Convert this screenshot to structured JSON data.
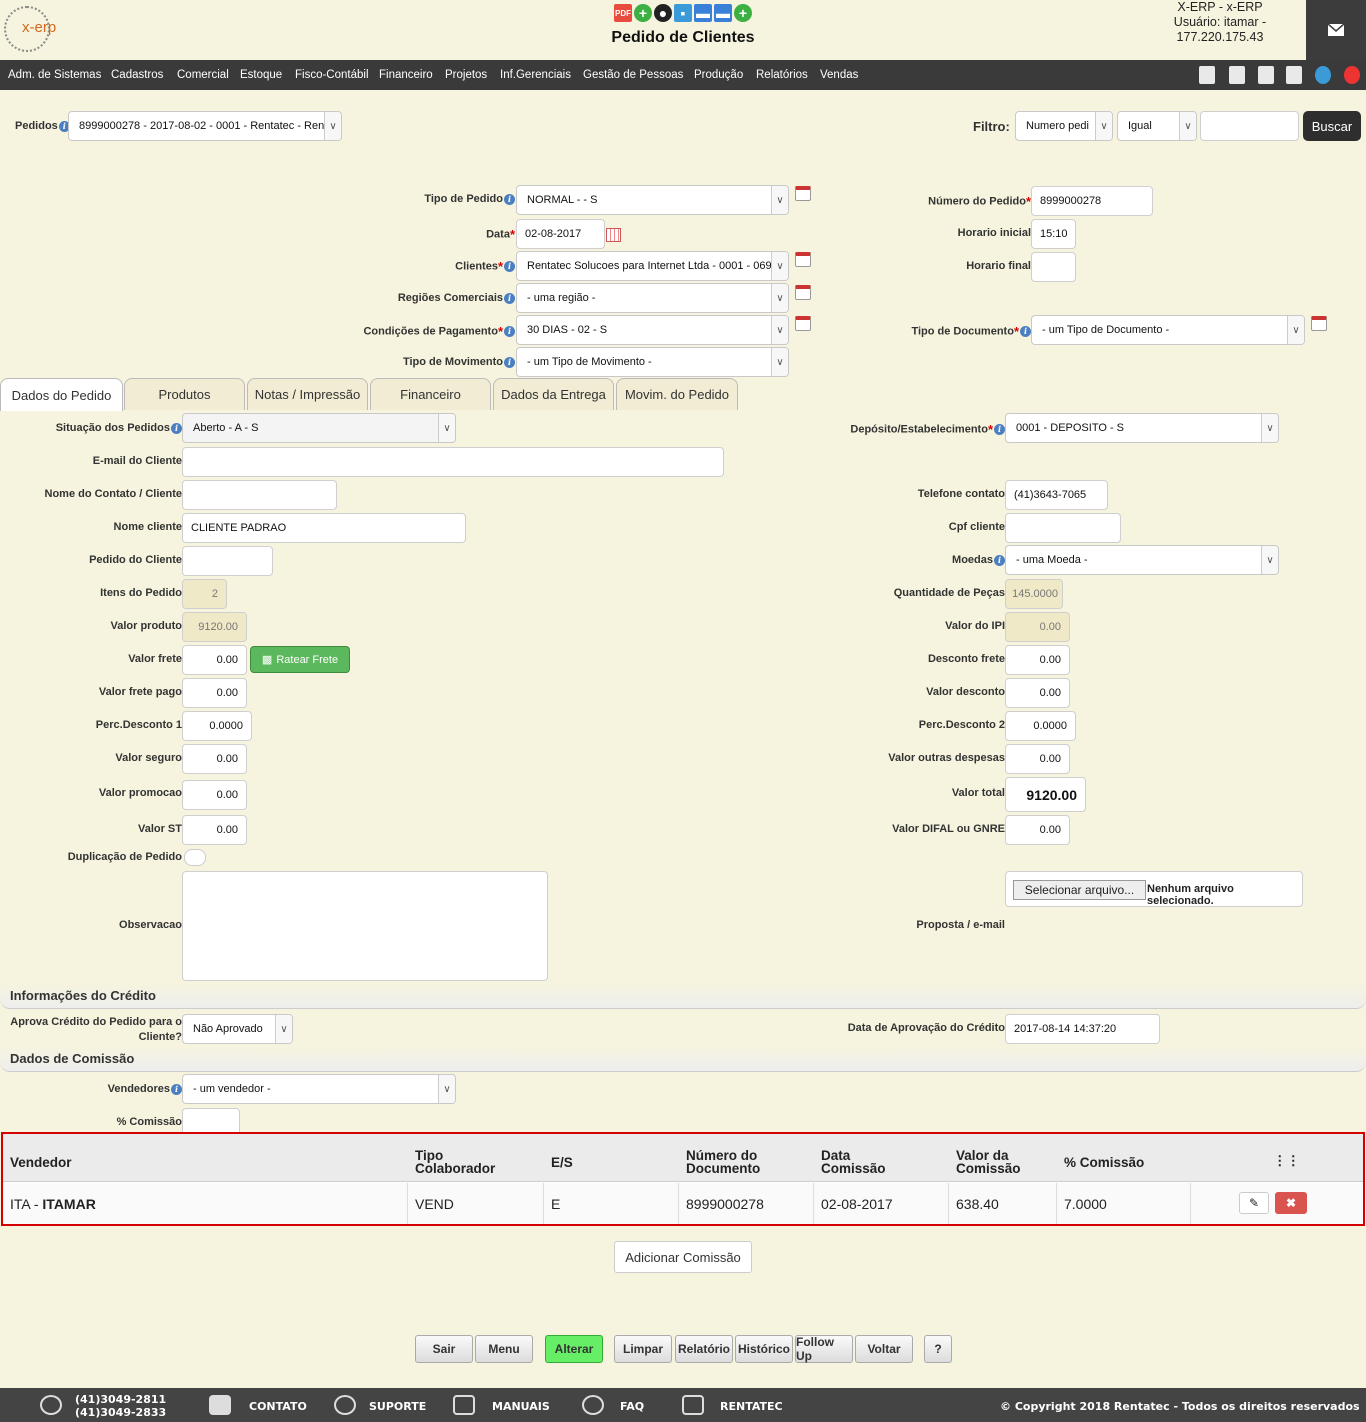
{
  "header": {
    "logo_text": "x-erp",
    "title": "Pedido de Clientes",
    "user_line1": "X-ERP - x-ERP",
    "user_line2": "Usuário: itamar -",
    "user_line3": "177.220.175.43"
  },
  "menu": [
    "Adm. de Sistemas",
    "Cadastros",
    "Comercial",
    "Estoque",
    "Fisco-Contábil",
    "Financeiro",
    "Projetos",
    "Inf.Gerenciais",
    "Gestão de Pessoas",
    "Produção",
    "Relatórios",
    "Vendas"
  ],
  "top": {
    "pedidos_label": "Pedidos",
    "pedidos_value": "8999000278 - 2017-08-02 - 0001 - Rentatec - Ren",
    "filtro_label": "Filtro:",
    "filtro_field": "Numero pedi",
    "filtro_op": "Igual",
    "filtro_value": "",
    "buscar": "Buscar"
  },
  "form": {
    "tipo_pedido_label": "Tipo de Pedido",
    "tipo_pedido": "NORMAL - - S",
    "data_label": "Data",
    "data": "02-08-2017",
    "clientes_label": "Clientes",
    "clientes": "Rentatec Solucoes para Internet Ltda - 0001 - 069",
    "regioes_label": "Regiões Comerciais",
    "regioes": "- uma região -",
    "condicoes_label": "Condições de Pagamento",
    "condicoes": "30 DIAS - 02 - S",
    "tipo_mov_label": "Tipo de Movimento",
    "tipo_mov": "- um Tipo de Movimento -",
    "numero_label": "Número do Pedido",
    "numero": "8999000278",
    "hora_ini_label": "Horario inicial",
    "hora_ini": "15:10",
    "hora_fim_label": "Horario final",
    "hora_fim": "",
    "tipo_doc_label": "Tipo de Documento",
    "tipo_doc": "- um Tipo de Documento -"
  },
  "tabs": [
    "Dados do Pedido",
    "Produtos",
    "Notas / Impressão",
    "Financeiro",
    "Dados da Entrega",
    "Movim. do Pedido"
  ],
  "left": {
    "situacao_label": "Situação dos Pedidos",
    "situacao": "Aberto - A - S",
    "email_label": "E-mail do Cliente",
    "email": "",
    "contato_label": "Nome do Contato / Cliente",
    "contato": "",
    "nome_label": "Nome cliente",
    "nome": "CLIENTE PADRAO",
    "pedcli_label": "Pedido do Cliente",
    "pedcli": "",
    "itens_label": "Itens do Pedido",
    "itens": "2",
    "vprod_label": "Valor produto",
    "vprod": "9120.00",
    "vfrete_label": "Valor frete",
    "vfrete": "0.00",
    "ratear": "Ratear Frete",
    "vfretepago_label": "Valor frete pago",
    "vfretepago": "0.00",
    "perc1_label": "Perc.Desconto 1",
    "perc1": "0.0000",
    "vseguro_label": "Valor seguro",
    "vseguro": "0.00",
    "vpromo_label": "Valor promocao",
    "vpromo": "0.00",
    "vst_label": "Valor ST",
    "vst": "0.00",
    "dup_label": "Duplicação de Pedido",
    "obs_label": "Observacao"
  },
  "right": {
    "deposito_label": "Depósito/Estabelecimento",
    "deposito": "0001 - DEPOSITO - S",
    "tel_label": "Telefone contato",
    "tel": "(41)3643-7065",
    "cpf_label": "Cpf cliente",
    "cpf": "",
    "moedas_label": "Moedas",
    "moedas": "- uma Moeda -",
    "qtd_label": "Quantidade de Peças",
    "qtd": "145.0000",
    "ipi_label": "Valor do IPI",
    "ipi": "0.00",
    "descfrete_label": "Desconto frete",
    "descfrete": "0.00",
    "vdesc_label": "Valor desconto",
    "vdesc": "0.00",
    "perc2_label": "Perc.Desconto 2",
    "perc2": "0.0000",
    "outras_label": "Valor outras despesas",
    "outras": "0.00",
    "total_label": "Valor total",
    "total": "9120.00",
    "difal_label": "Valor DIFAL ou GNRE",
    "difal": "0.00",
    "arquivo_btn": "Selecionar arquivo...",
    "arquivo_txt": "Nenhum arquivo selecionado.",
    "proposta_label": "Proposta / e-mail"
  },
  "credito": {
    "title": "Informações do Crédito",
    "aprova_label1": "Aprova Crédito do Pedido para o",
    "aprova_label2": "Cliente?",
    "aprova": "Não Aprovado",
    "data_label": "Data de Aprovação do Crédito",
    "data": "2017-08-14 14:37:20"
  },
  "comissao": {
    "title": "Dados de Comissão",
    "vend_label": "Vendedores",
    "vend": "- um vendedor -",
    "perc_label": "% Comissão",
    "perc": "",
    "headers": [
      "Vendedor",
      "Tipo Colaborador",
      "E/S",
      "Número do Documento",
      "Data Comissão",
      "Valor da Comissão",
      "% Comissão"
    ],
    "row": {
      "vend_code": "ITA - ",
      "vend_name": "ITAMAR",
      "tipo": "VEND",
      "es": "E",
      "numero": "8999000278",
      "data": "02-08-2017",
      "valor": "638.40",
      "perc": "7.0000"
    },
    "add": "Adicionar Comissão"
  },
  "buttons": [
    "Sair",
    "Menu",
    "Alterar",
    "Limpar",
    "Relatório",
    "Histórico",
    "Follow Up",
    "Voltar",
    "?"
  ],
  "footer": {
    "phone1": "(41)3049-2811",
    "phone2": "(41)3049-2833",
    "contato": "CONTATO",
    "suporte": "SUPORTE",
    "manuais": "MANUAIS",
    "faq": "FAQ",
    "rentatec": "RENTATEC",
    "copyright": "© Copyright 2018 Rentatec - Todos os direitos reservados"
  },
  "colors": {
    "menubar": "#3a3a3a",
    "background": "#f6f4de",
    "alterar": "#66ee66",
    "ratear": "#5cb85c",
    "delete": "#d9534f",
    "highlight": "#d40000"
  }
}
